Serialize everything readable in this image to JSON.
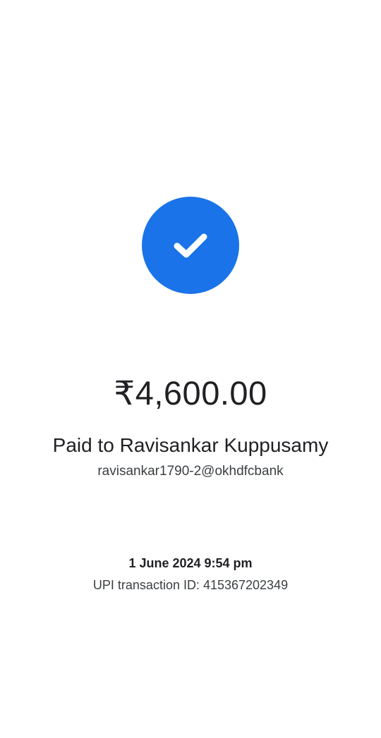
{
  "status": {
    "icon": "check-icon",
    "accent_color": "#1a73e8"
  },
  "payment": {
    "amount": "₹4,600.00",
    "payee_line": "Paid to Ravisankar Kuppusamy",
    "payee_upi": "ravisankar1790-2@okhdfcbank"
  },
  "transaction": {
    "datetime": "1 June 2024 9:54 pm",
    "upi_txn_id": "UPI transaction ID: 415367202349"
  }
}
